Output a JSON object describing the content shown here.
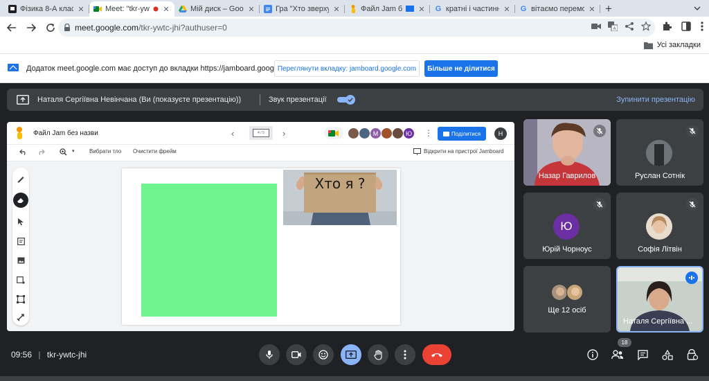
{
  "tabs": [
    {
      "label": "Фізика 8-А клас",
      "favicon_color": "#202124"
    },
    {
      "label": "Meet: \"tkr-ywtc-jhi\"",
      "favicon_color": "#00832d",
      "active": true,
      "recording": true
    },
    {
      "label": "Мій диск – Google",
      "favicon_color": "#1fa463"
    },
    {
      "label": "Гра \"Хто зверху?\"",
      "favicon_color": "#4285f4"
    },
    {
      "label": "Файл Jam без назви",
      "favicon_color": "#fbbc04"
    },
    {
      "label": "кратні і частинні",
      "favicon_color": "#4285f4"
    },
    {
      "label": "вітаємо переможців",
      "favicon_color": "#4285f4"
    }
  ],
  "address": {
    "host": "meet.google.com",
    "path": "/tkr-ywtc-jhi?authuser=0"
  },
  "bookmarks": {
    "all_label": "Усі закладки"
  },
  "banner": {
    "message": "Додаток meet.google.com має доступ до вкладки https://jamboard.google.com",
    "view_tab": "Переглянути вкладку: jamboard.google.com",
    "stop_sharing": "Більше не ділитися"
  },
  "presenting": {
    "text": "Наталя Сергіївна Невінчана (Ви (показуєте презентацію))",
    "sound_label": "Звук презентації",
    "sound_on": true,
    "stop": "Зупинити презентацію"
  },
  "jamboard": {
    "title": "Файл Jam без назви",
    "frame_indicator": "4 / 5",
    "share": "Поділитися",
    "user_initial": "Н",
    "collaborators": [
      {
        "initial": "",
        "color": "#7b5a4a"
      },
      {
        "initial": "",
        "color": "#4b6584"
      },
      {
        "initial": "М",
        "color": "#8e5fa8"
      },
      {
        "initial": "",
        "color": "#a0522d"
      },
      {
        "initial": "",
        "color": "#6b4b3e"
      },
      {
        "initial": "Ю",
        "color": "#6b2fa3"
      }
    ],
    "tools": {
      "choose_bg": "Вибрати тло",
      "clear_frame": "Очистити фрейм",
      "open_device": "Відкрити на пристрої Jamboard"
    },
    "image_text": "Хто я ?",
    "note_color": "#6ff58f"
  },
  "participants": [
    {
      "name": "Назар Гаврилов",
      "type": "video",
      "muted": true
    },
    {
      "name": "Руслан Сотнік",
      "type": "avatar",
      "muted": true,
      "color": "#5f6368"
    },
    {
      "name": "Юрій Чорноус",
      "type": "initial",
      "initial": "Ю",
      "muted": true,
      "color": "#6b2fa3"
    },
    {
      "name": "Софія Літвін",
      "type": "avatar",
      "muted": true,
      "color": "#d9c2a8"
    },
    {
      "name": "Ще 12 осіб",
      "type": "group"
    },
    {
      "name": "Наталя Сергіївна ...",
      "type": "video",
      "speaking": true
    }
  ],
  "bottom": {
    "time": "09:56",
    "separator": "|",
    "meeting_code": "tkr-ywtc-jhi",
    "people_count": "18"
  }
}
